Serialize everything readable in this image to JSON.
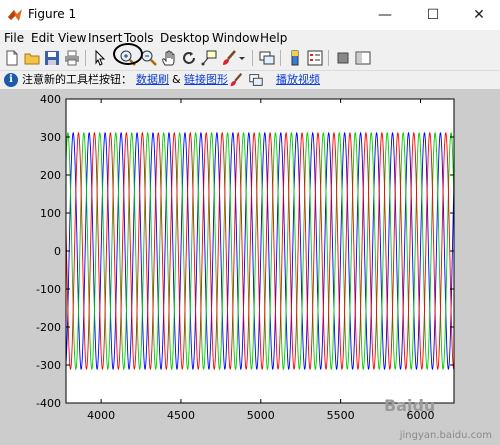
{
  "window": {
    "title": "Figure 1",
    "controls": {
      "minimize": "—",
      "maximize": "☐",
      "close": "✕"
    }
  },
  "menu": [
    "File",
    "Edit",
    "View",
    "Insert",
    "Tools",
    "Desktop",
    "Window",
    "Help"
  ],
  "toolbar": {
    "buttons": [
      "new-figure-icon",
      "open-file-icon",
      "save-icon",
      "print-icon",
      "select-arrow-icon",
      "zoom-in-icon",
      "zoom-out-icon",
      "pan-hand-icon",
      "rotate-3d-icon",
      "data-cursor-icon",
      "brush-icon",
      "link-plot-icon",
      "colorbar-icon",
      "legend-icon",
      "hide-tools-icon",
      "show-tools-icon"
    ]
  },
  "infobar": {
    "icon": "info-icon",
    "text": "注意新的工具栏按钮：",
    "link1": "数据刷",
    "amp": "&",
    "link2": "链接图形",
    "link3": "播放视频"
  },
  "watermark": {
    "mark": "Baidu",
    "text": "jingyan.baidu.com"
  },
  "colors": {
    "series1": "#0000ff",
    "series2": "#00cc00",
    "series3": "#ff0000",
    "background": "#cccccc",
    "axes": "#ffffff"
  },
  "chart_data": {
    "type": "line",
    "title": "",
    "xlabel": "",
    "ylabel": "",
    "xlim": [
      3780,
      6210
    ],
    "ylim": [
      -400,
      400
    ],
    "xticks": [
      4000,
      4500,
      5000,
      5500,
      6000
    ],
    "yticks": [
      400,
      300,
      200,
      100,
      0,
      -100,
      -200,
      -300,
      -400
    ],
    "grid": false,
    "series": [
      {
        "color": "#0000ff",
        "amplitude": 311,
        "period": 100,
        "phase_deg": 0,
        "x_range": [
          3780,
          6210
        ]
      },
      {
        "color": "#00cc00",
        "amplitude": 311,
        "period": 100,
        "phase_deg": 120,
        "x_range": [
          3780,
          6210
        ]
      },
      {
        "color": "#ff0000",
        "amplitude": 311,
        "period": 100,
        "phase_deg": -120,
        "x_range": [
          3780,
          6210
        ]
      }
    ]
  }
}
